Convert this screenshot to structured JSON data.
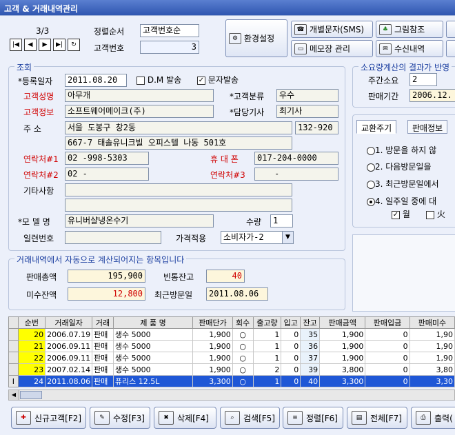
{
  "window": {
    "title": "고객 & 거래내역관리"
  },
  "nav": {
    "position": "3/3"
  },
  "sort": {
    "label": "정렬순서",
    "value": "고객번호순"
  },
  "custno": {
    "label": "고객번호",
    "value": "3"
  },
  "toolbar": {
    "settings": "환경설정",
    "sms": "개별문자(SMS)",
    "picture": "그림참조",
    "memo": "메모장 관리",
    "received": "수신내역"
  },
  "lookup": {
    "title": "조회",
    "reg_date_label": "*등록일자",
    "reg_date": "2011.08.20",
    "dm_label": "D.M 발송",
    "sms_label": "문자발송",
    "name_label": "고객성명",
    "name": "아무개",
    "category_label": "*고객분류",
    "category": "우수",
    "info_label": "고객정보",
    "info": "소프트웨어메이크(주)",
    "tech_label": "*담당기사",
    "tech": "최기사",
    "addr_label": "주    소",
    "addr1": "서울 도봉구 창2동",
    "zip": "132-920",
    "addr2": "667-7 태솔유니크빌 오피스텔 나동 501호",
    "contact1_label": "연락처#1",
    "contact1": "02  -998-5303",
    "mobile_label": "휴 대 폰",
    "mobile": "017-204-0000",
    "contact2_label": "연락처#2",
    "contact2": "02  -",
    "contact3_label": "연락처#3",
    "contact3": "-",
    "memo_label": "기타사항",
    "memo1": "",
    "memo2": "",
    "model_label": "*모 델 명",
    "model": "유니버샬냉온수기",
    "qty_label": "수량",
    "qty": "1",
    "serial_label": "일련번호",
    "serial": "",
    "price_label": "가격적용",
    "price": "소비자가-2"
  },
  "consumption": {
    "title": "소요량계산의 결과가 반영",
    "weeks_label": "주간소요",
    "weeks": "2",
    "period_label": "판매기간",
    "period": "2006.12."
  },
  "tabs": {
    "exchange": "교환주기",
    "sales": "판매정보"
  },
  "options": [
    {
      "label": "1. 방문을 하지 않",
      "selected": false
    },
    {
      "label": "2. 다음방문일을",
      "selected": false
    },
    {
      "label": "3. 최근방문일에서",
      "selected": false
    },
    {
      "label": "4. 일주일 중에 대",
      "selected": true
    }
  ],
  "days": {
    "mon": "월",
    "tue": "火"
  },
  "auto": {
    "title": "거래내역에서 자동으로 계산되어지는 항목입니다",
    "total_label": "판매총액",
    "total": "195,900",
    "bottle_label": "빈통잔고",
    "bottle": "40",
    "unpaid_label": "미수잔액",
    "unpaid": "12,800",
    "lastvisit_label": "최근방문일",
    "lastvisit": "2011.08.06"
  },
  "grid": {
    "headers": [
      "순번",
      "거래일자",
      "거래",
      "제  품  명",
      "판매단가",
      "회수",
      "출고량",
      "입고",
      "잔고",
      "판매금액",
      "판매입금",
      "판매미수"
    ],
    "rows": [
      [
        "20",
        "2006.07.19",
        "판매",
        "생수 5000",
        "1,900",
        "○",
        "1",
        "0",
        "35",
        "1,900",
        "0",
        "1,90"
      ],
      [
        "21",
        "2006.09.11",
        "판매",
        "생수 5000",
        "1,900",
        "○",
        "1",
        "0",
        "36",
        "1,900",
        "0",
        "1,90"
      ],
      [
        "22",
        "2006.09.11",
        "판매",
        "생수 5000",
        "1,900",
        "○",
        "1",
        "0",
        "37",
        "1,900",
        "0",
        "1,90"
      ],
      [
        "23",
        "2007.02.14",
        "판매",
        "생수 5000",
        "1,900",
        "○",
        "2",
        "0",
        "39",
        "3,800",
        "0",
        "3,80"
      ],
      [
        "24",
        "2011.08.06",
        "판매",
        "퓨리스 12.5L",
        "3,300",
        "○",
        "1",
        "0",
        "40",
        "3,300",
        "0",
        "3,30"
      ]
    ]
  },
  "buttons": {
    "new": "신규고객[F2]",
    "edit": "수정[F3]",
    "delete": "삭제[F4]",
    "search": "검색[F5]",
    "sort": "정렬[F6]",
    "all": "전체[F7]",
    "print": "출력("
  }
}
